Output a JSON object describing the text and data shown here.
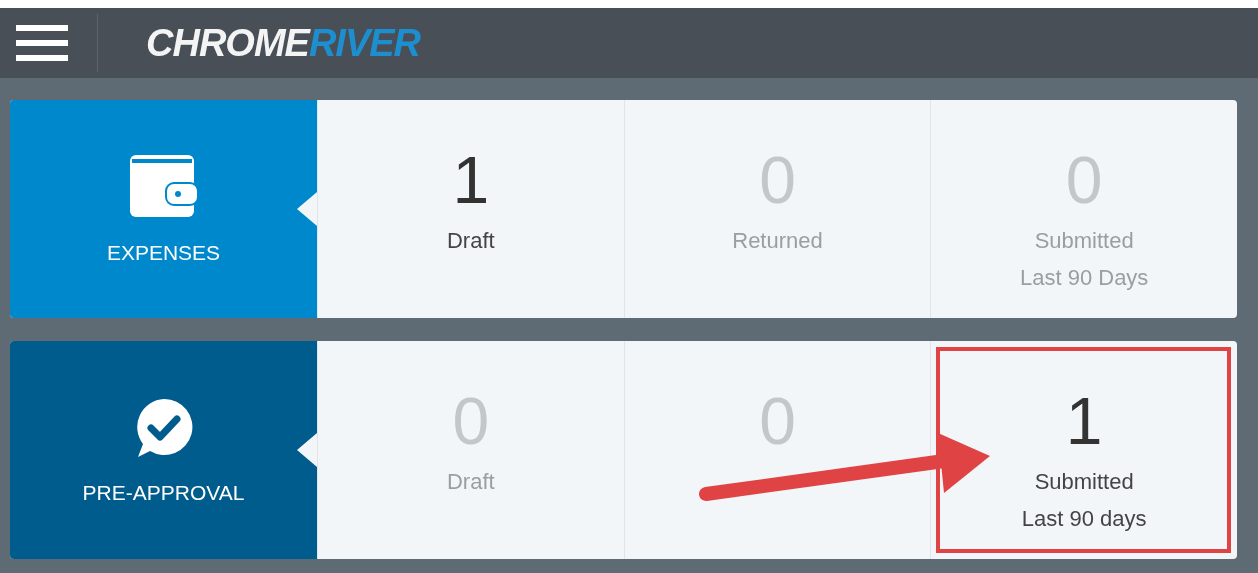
{
  "header": {
    "logo": {
      "text": "CHROME",
      "accent": "RIVER"
    }
  },
  "sections": [
    {
      "label": "EXPENSES",
      "kind": "expenses",
      "stats": [
        {
          "value": "1",
          "label": "Draft",
          "active": true,
          "highlighted": false
        },
        {
          "value": "0",
          "label": "Returned",
          "active": false,
          "highlighted": false
        },
        {
          "value": "0",
          "label": "Submitted\nLast 90 Days",
          "active": false,
          "highlighted": false
        }
      ]
    },
    {
      "label": "PRE-APPROVAL",
      "kind": "pre-approval",
      "stats": [
        {
          "value": "0",
          "label": "Draft",
          "active": false,
          "highlighted": false
        },
        {
          "value": "0",
          "active": false,
          "highlighted": false
        },
        {
          "value": "1",
          "label": "Submitted\nLast 90 days",
          "active": true,
          "highlighted": true
        }
      ]
    }
  ]
}
